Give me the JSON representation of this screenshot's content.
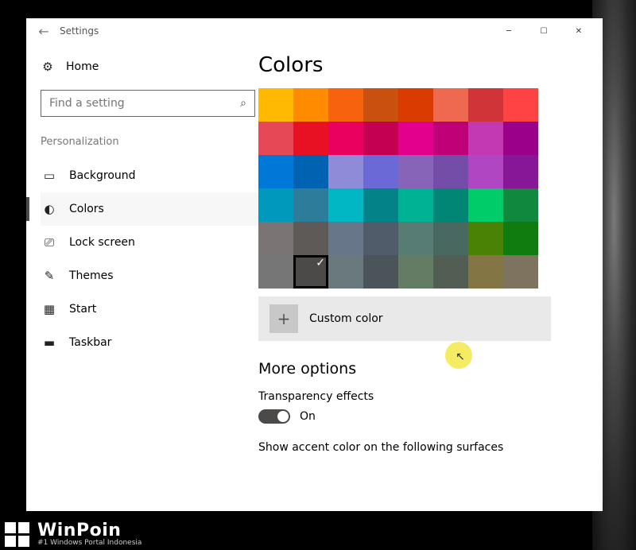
{
  "titlebar": {
    "back_glyph": "←",
    "title": "Settings"
  },
  "sidebar": {
    "home": "Home",
    "search_placeholder": "Find a setting",
    "section": "Personalization",
    "items": [
      {
        "label": "Background",
        "icon": "image-icon"
      },
      {
        "label": "Colors",
        "icon": "palette-icon"
      },
      {
        "label": "Lock screen",
        "icon": "lockscreen-icon"
      },
      {
        "label": "Themes",
        "icon": "paintbrush-icon"
      },
      {
        "label": "Start",
        "icon": "grid-icon"
      },
      {
        "label": "Taskbar",
        "icon": "taskbar-icon"
      }
    ],
    "active_index": 1
  },
  "main": {
    "heading": "Colors",
    "palette_rows": [
      [
        "#ffb900",
        "#ff8c00",
        "#f7630c",
        "#ca5010",
        "#da3b01",
        "#ef6950",
        "#d13438",
        "#ff4343"
      ],
      [
        "#e74856",
        "#e81123",
        "#ea005e",
        "#c30052",
        "#e3008c",
        "#bf0077",
        "#c239b3",
        "#9a0089"
      ],
      [
        "#0078d7",
        "#0063b1",
        "#8e8cd8",
        "#6b69d6",
        "#8764b8",
        "#744da9",
        "#b146c2",
        "#881798"
      ],
      [
        "#0099bc",
        "#2d7d9a",
        "#00b7c3",
        "#038387",
        "#00b294",
        "#018574",
        "#00cc6a",
        "#10893e"
      ],
      [
        "#7a7574",
        "#5d5a58",
        "#68768a",
        "#515c6b",
        "#567c73",
        "#486860",
        "#498205",
        "#107c10"
      ],
      [
        "#767676",
        "#4c4a48",
        "#69797e",
        "#4a5459",
        "#647c64",
        "#525e54",
        "#847545",
        "#7e735f"
      ]
    ],
    "selected": [
      5,
      1
    ],
    "custom_label": "Custom color",
    "more_options": "More options",
    "transparency_label": "Transparency effects",
    "transparency_state": "On",
    "accent_surfaces_label": "Show accent color on the following surfaces"
  },
  "watermark": {
    "name": "WinPoin",
    "tagline": "#1 Windows Portal Indonesia"
  }
}
